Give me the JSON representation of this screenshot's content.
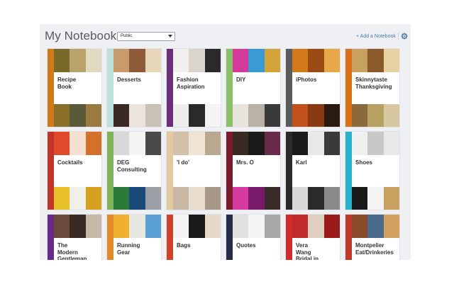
{
  "header": {
    "title": "My Notebooks",
    "visibility_value": "Public",
    "add_label": "+ Add a Notebook"
  },
  "notebooks": [
    {
      "title": "Recipe\nBook",
      "spine": "#d07a1a",
      "top": [
        "#7a6a2a",
        "#b9a36a",
        "#e1d9c0"
      ],
      "bottom": [
        "#8a6f2a",
        "#5a5a3a",
        "#9b7a3f"
      ]
    },
    {
      "title": "Desserts",
      "spine": "#bfe0dc",
      "top": [
        "#c99a6a",
        "#8f5a3a",
        "#e8d6b8"
      ],
      "bottom": [
        "#3b2a24",
        "#eae4dc",
        "#c9c1b5"
      ]
    },
    {
      "title": "Fashion\nAspiration",
      "spine": "#6b2f7a",
      "top": [
        "#f0f0f0",
        "#d9d4cc",
        "#2a2a2a"
      ],
      "bottom": [
        "#eeeeee",
        "#2a2a2a",
        "#f4f4f4"
      ]
    },
    {
      "title": "DIY",
      "spine": "#8bbf6a",
      "top": [
        "#d43a9a",
        "#3a9ad4",
        "#d4a43a"
      ],
      "bottom": [
        "#e8e4dc",
        "#b9b2a6",
        "#3a3a3a"
      ]
    },
    {
      "title": "iPhotos",
      "spine": "#5b5b5b",
      "top": [
        "#d27a1a",
        "#9a4a12",
        "#e8a84a"
      ],
      "bottom": [
        "#c2501a",
        "#8a3a12",
        "#2a1a10"
      ]
    },
    {
      "title": "Skinnytaste\nThanksgiving",
      "spine": "#d8701a",
      "top": [
        "#c8a060",
        "#8a5a2a",
        "#e8d0a0"
      ],
      "bottom": [
        "#8a6a3a",
        "#b8a060",
        "#d8c8a0"
      ]
    },
    {
      "title": "Cocktails",
      "spine": "#c0352a",
      "top": [
        "#e04a2a",
        "#f4e0d0",
        "#d4702a"
      ],
      "bottom": [
        "#e8c02a",
        "#f0f0e8",
        "#d8a020"
      ]
    },
    {
      "title": "DEG\nConsulting",
      "spine": "#7fb35a",
      "top": [
        "#d8d8d8",
        "#f4f4f4",
        "#4a4a4a"
      ],
      "bottom": [
        "#2a7a3a",
        "#1a4a7a",
        "#9aa0a6"
      ]
    },
    {
      "title": "'I do'",
      "spine": "#e2c9a0",
      "top": [
        "#d4c0a8",
        "#f0e4d4",
        "#b8a890"
      ],
      "bottom": [
        "#c8b8a4",
        "#e8dccc",
        "#a89888"
      ]
    },
    {
      "title": "Mrs. O",
      "spine": "#7a1a2a",
      "top": [
        "#3a2a24",
        "#1a1a1a",
        "#6a2a4a"
      ],
      "bottom": [
        "#d43aa0",
        "#7a1a6a",
        "#3a2a2a"
      ]
    },
    {
      "title": "Karl",
      "spine": "#2a2a2a",
      "top": [
        "#1a1a1a",
        "#e8e8e8",
        "#3a3a3a"
      ],
      "bottom": [
        "#d8d8d8",
        "#2a2a2a",
        "#8a8a8a"
      ]
    },
    {
      "title": "Shoes",
      "spine": "#2ab0c8",
      "top": [
        "#f0f0f0",
        "#c8c8c8",
        "#e8e8e8"
      ],
      "bottom": [
        "#1a1a1a",
        "#f4f4f4",
        "#c8a060"
      ]
    },
    {
      "title": "The\nModern\nGentleman",
      "spine": "#6a2a8a",
      "top": [
        "#6a4a3a",
        "#3a2a24",
        "#c8b8a8"
      ],
      "bottom": []
    },
    {
      "title": "Running\nGear",
      "spine": "#e08a2a",
      "top": [
        "#f0b030",
        "#e8e8e0",
        "#5aa0d4"
      ],
      "bottom": []
    },
    {
      "title": "Bags",
      "spine": "#d0402a",
      "top": [
        "#f4f4f4",
        "#1a1a1a",
        "#e8d8c8"
      ],
      "bottom": []
    },
    {
      "title": "Quotes",
      "spine": "#2a2a4a",
      "top": [
        "#e0e0e0",
        "#f4f4f4",
        "#a8a8a8"
      ],
      "bottom": []
    },
    {
      "title": "Vera\nWang\nBridal in",
      "spine": "#d02a2a",
      "top": [
        "#c02a2a",
        "#e0d0c0",
        "#9a1a1a"
      ],
      "bottom": []
    },
    {
      "title": "Montpelier\nEat/Drinkeries",
      "spine": "#c03a2a",
      "top": [
        "#8a4a2a",
        "#4a6a8a",
        "#d4a060"
      ],
      "bottom": []
    }
  ]
}
